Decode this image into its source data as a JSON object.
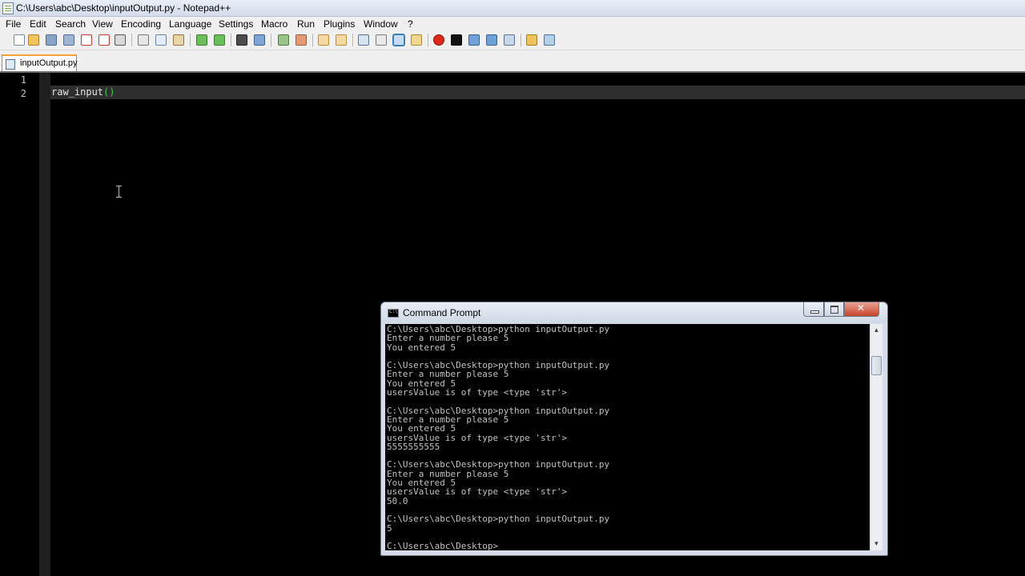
{
  "window": {
    "title": "C:\\Users\\abc\\Desktop\\inputOutput.py - Notepad++"
  },
  "menu": [
    "File",
    "Edit",
    "Search",
    "View",
    "Encoding",
    "Language",
    "Settings",
    "Macro",
    "Run",
    "Plugins",
    "Window",
    "?"
  ],
  "tab": {
    "label": "inputOutput.py"
  },
  "editor": {
    "line_numbers": [
      "1",
      "2"
    ],
    "code": {
      "func": "raw_input",
      "parens": "()"
    }
  },
  "cmd": {
    "title": "Command Prompt",
    "output": "C:\\Users\\abc\\Desktop>python inputOutput.py\nEnter a number please 5\nYou entered 5\n\nC:\\Users\\abc\\Desktop>python inputOutput.py\nEnter a number please 5\nYou entered 5\nusersValue is of type <type 'str'>\n\nC:\\Users\\abc\\Desktop>python inputOutput.py\nEnter a number please 5\nYou entered 5\nusersValue is of type <type 'str'>\n5555555555\n\nC:\\Users\\abc\\Desktop>python inputOutput.py\nEnter a number please 5\nYou entered 5\nusersValue is of type <type 'str'>\n50.0\n\nC:\\Users\\abc\\Desktop>python inputOutput.py\n5\n\nC:\\Users\\abc\\Desktop>"
  },
  "colors": {
    "editor_bg": "#000000",
    "caret_line": "#2e2e2e",
    "paren": "#38d04f",
    "console_text": "#c0c0c0",
    "close_button": "#c7432a"
  }
}
